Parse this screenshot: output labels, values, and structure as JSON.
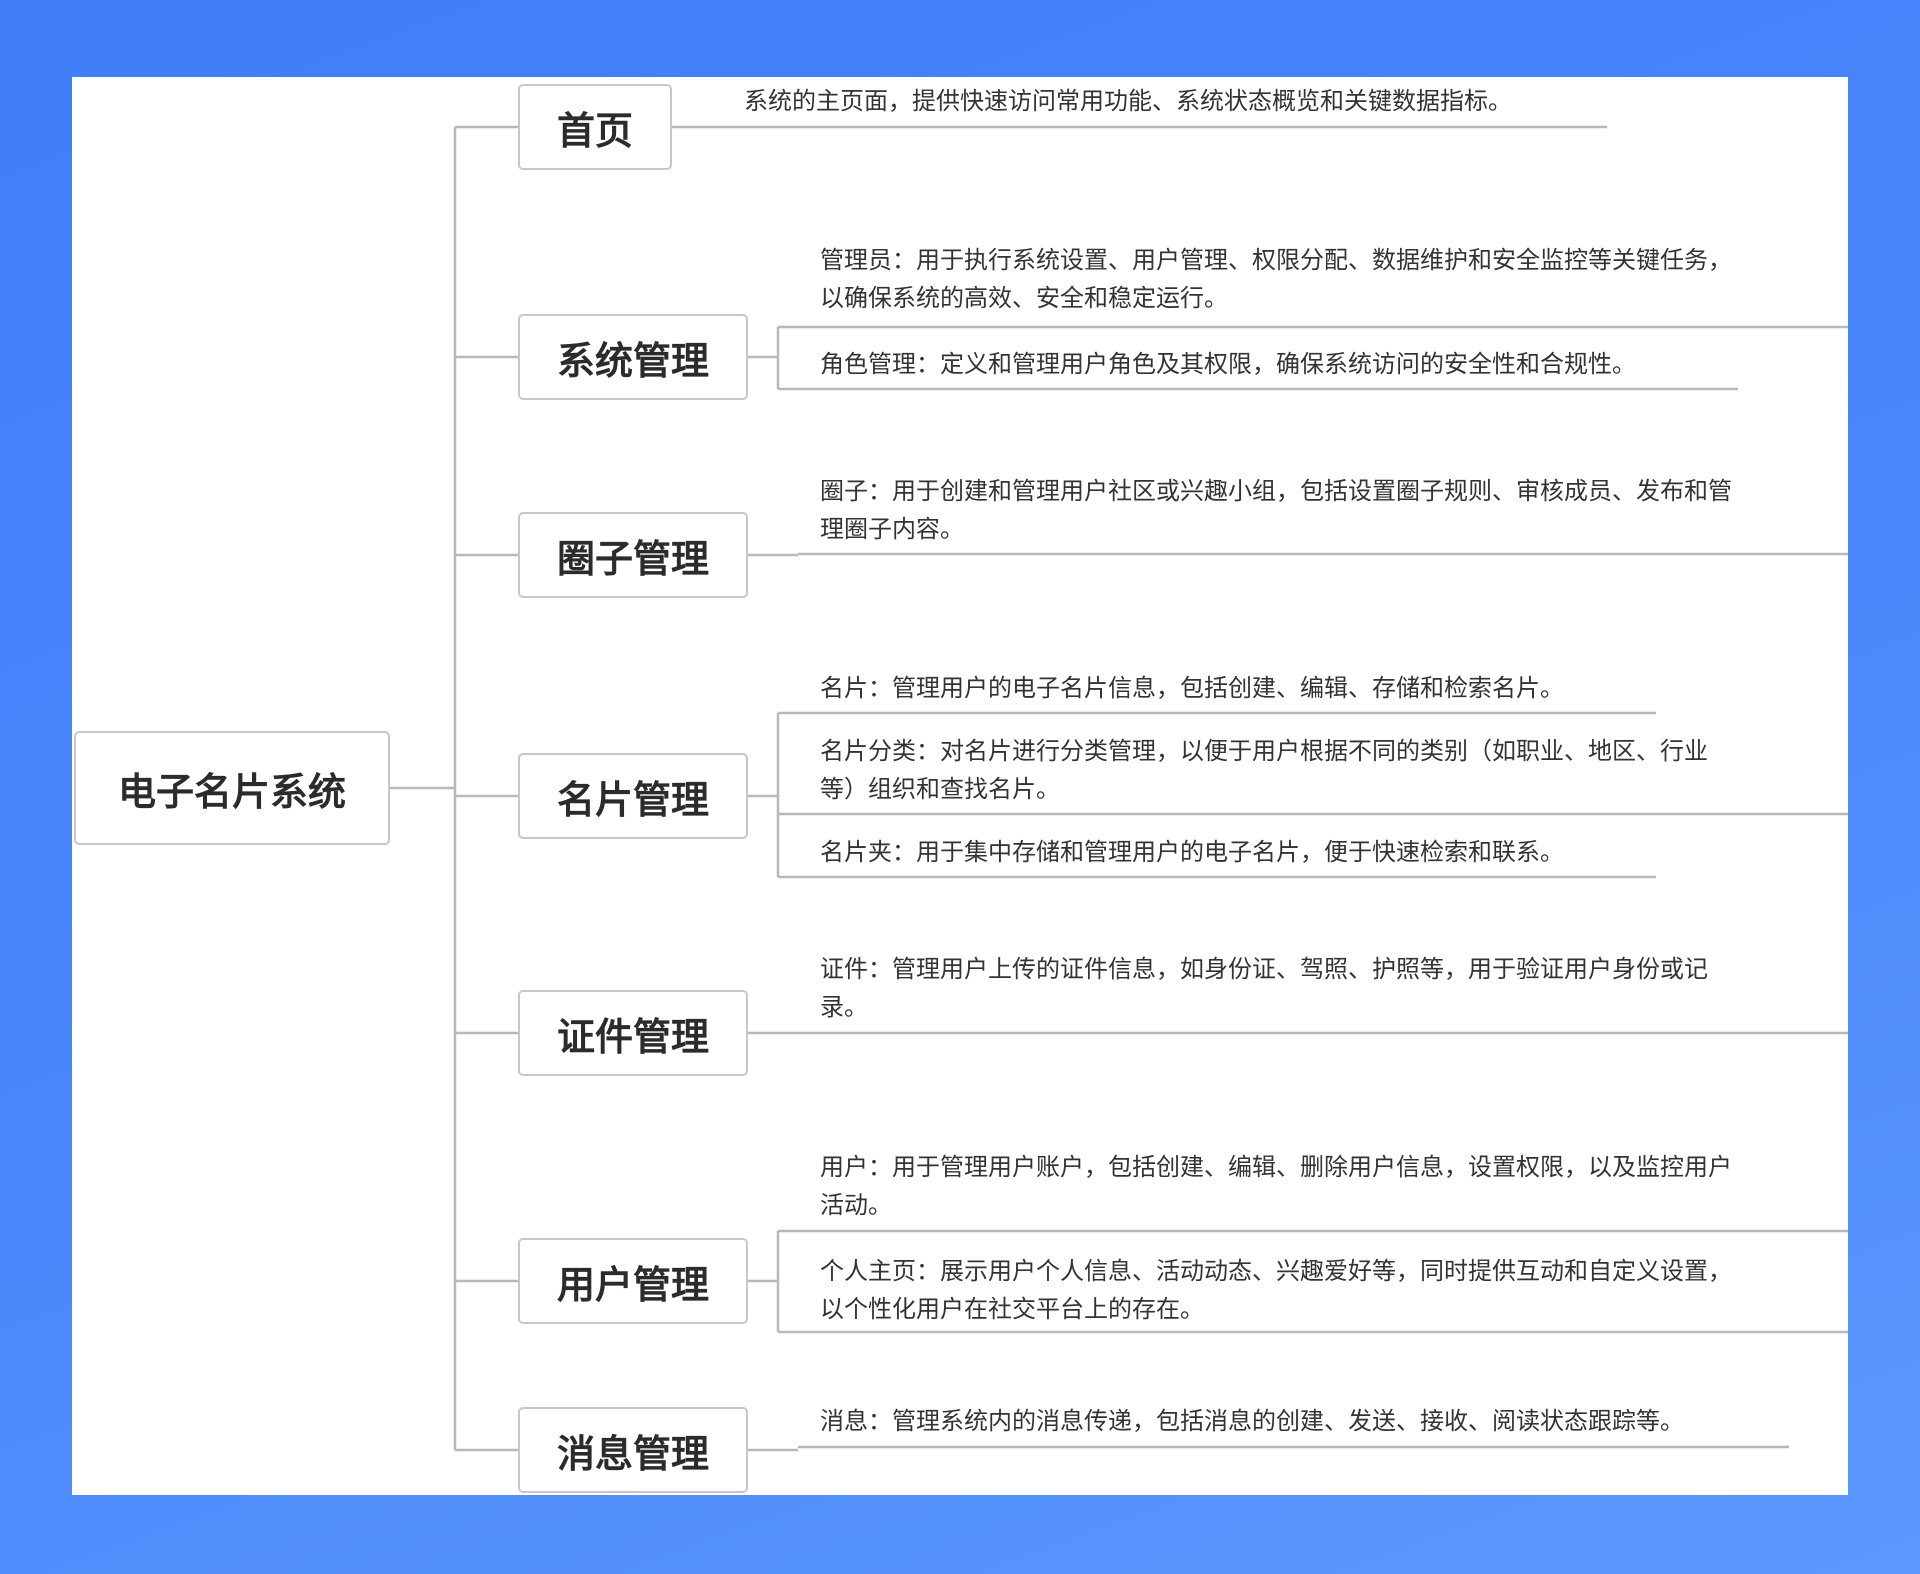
{
  "root": {
    "label": "电子名片系统"
  },
  "branches": [
    {
      "label": "首页",
      "leaves": [
        "系统的主页面，提供快速访问常用功能、系统状态概览和关键数据指标。"
      ]
    },
    {
      "label": "系统管理",
      "leaves": [
        "管理员：用于执行系统设置、用户管理、权限分配、数据维护和安全监控等关键任务，\n以确保系统的高效、安全和稳定运行。",
        "角色管理：定义和管理用户角色及其权限，确保系统访问的安全性和合规性。"
      ]
    },
    {
      "label": "圈子管理",
      "leaves": [
        "圈子：用于创建和管理用户社区或兴趣小组，包括设置圈子规则、审核成员、发布和管\n理圈子内容。"
      ]
    },
    {
      "label": "名片管理",
      "leaves": [
        "名片：管理用户的电子名片信息，包括创建、编辑、存储和检索名片。",
        "名片分类：对名片进行分类管理，以便于用户根据不同的类别（如职业、地区、行业\n等）组织和查找名片。",
        "名片夹：用于集中存储和管理用户的电子名片，便于快速检索和联系。"
      ]
    },
    {
      "label": "证件管理",
      "leaves": [
        "证件：管理用户上传的证件信息，如身份证、驾照、护照等，用于验证用户身份或记\n录。"
      ]
    },
    {
      "label": "用户管理",
      "leaves": [
        "用户：用于管理用户账户，包括创建、编辑、删除用户信息，设置权限，以及监控用户\n活动。",
        "个人主页：展示用户个人信息、活动动态、兴趣爱好等，同时提供互动和自定义设置，\n以个性化用户在社交平台上的存在。"
      ]
    },
    {
      "label": "消息管理",
      "leaves": [
        "消息：管理系统内的消息传递，包括消息的创建、发送、接收、阅读状态跟踪等。"
      ]
    }
  ]
}
